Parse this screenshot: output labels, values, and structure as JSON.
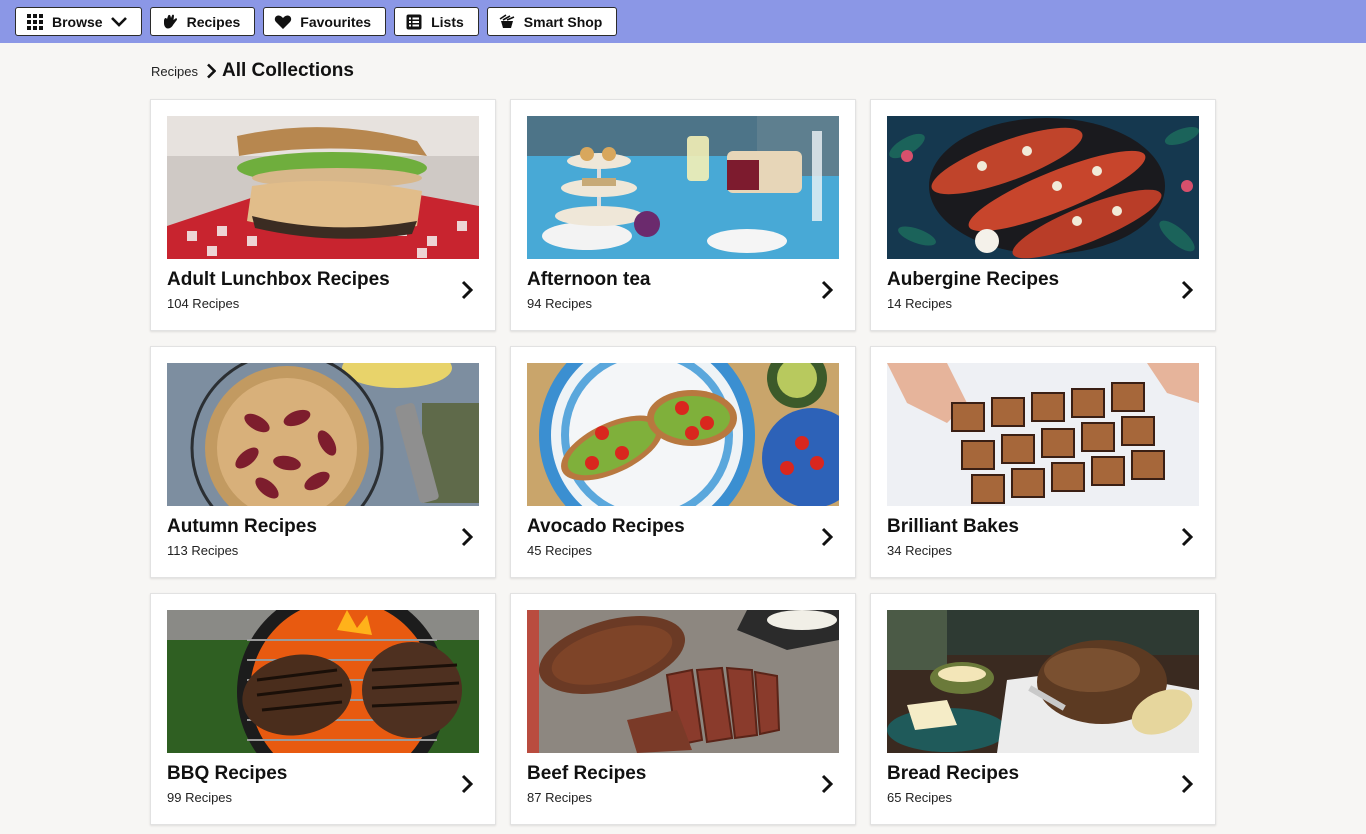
{
  "nav": {
    "browse": "Browse",
    "recipes": "Recipes",
    "favourites": "Favourites",
    "lists": "Lists",
    "smart_shop": "Smart Shop"
  },
  "breadcrumb": {
    "parent": "Recipes",
    "current": "All Collections"
  },
  "collections": [
    {
      "title": "Adult Lunchbox Recipes",
      "count": "104 Recipes"
    },
    {
      "title": "Afternoon tea",
      "count": "94 Recipes"
    },
    {
      "title": "Aubergine Recipes",
      "count": "14 Recipes"
    },
    {
      "title": "Autumn Recipes",
      "count": "113 Recipes"
    },
    {
      "title": "Avocado Recipes",
      "count": "45 Recipes"
    },
    {
      "title": "Brilliant Bakes",
      "count": "34 Recipes"
    },
    {
      "title": "BBQ Recipes",
      "count": "99 Recipes"
    },
    {
      "title": "Beef Recipes",
      "count": "87 Recipes"
    },
    {
      "title": "Bread Recipes",
      "count": "65 Recipes"
    }
  ],
  "colors": {
    "topbar": "#8b97e6",
    "page_bg": "#f7f6f4"
  }
}
